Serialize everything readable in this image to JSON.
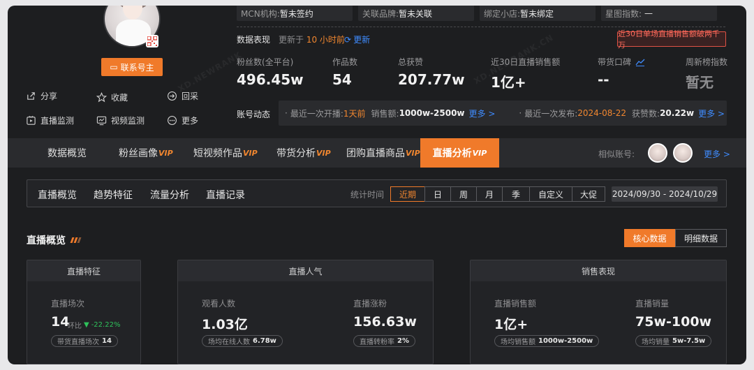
{
  "profile": {
    "contact_button": "联系号主",
    "actions": [
      {
        "label": "分享",
        "icon": "share-icon"
      },
      {
        "label": "收藏",
        "icon": "star-icon"
      },
      {
        "label": "回采",
        "icon": "enter-icon"
      },
      {
        "label": "直播监测",
        "icon": "live-monitor-icon"
      },
      {
        "label": "视频监测",
        "icon": "video-monitor-icon"
      },
      {
        "label": "更多",
        "icon": "more-icon"
      }
    ]
  },
  "info_top": {
    "mcn_label": "MCN机构:",
    "mcn_value": "暂未签约",
    "brand_label": "关联品牌:",
    "brand_value": "暂未关联",
    "shop_label": "绑定小店:",
    "shop_value": "暂未绑定",
    "star_label": "星图指数:",
    "star_value": "—"
  },
  "data_perf": {
    "title": "数据表现",
    "updated_prefix": "更新于",
    "updated_value": "10 小时前",
    "refresh": "更新",
    "alert": "近30日单场直播销售额破两千万"
  },
  "stats": [
    {
      "label": "粉丝数(全平台)",
      "value": "496.45w"
    },
    {
      "label": "作品数",
      "value": "54"
    },
    {
      "label": "总获赞",
      "value": "207.77w"
    },
    {
      "label": "近30日直播销售额",
      "value": "1亿+"
    },
    {
      "label": "带货口碑",
      "value": "--"
    },
    {
      "label": "周新榜指数",
      "value": "暂无"
    }
  ],
  "dynamics": {
    "title": "账号动态",
    "live_label": "最近一次开播:",
    "live_value": "1天前",
    "sales_label": "销售额:",
    "sales_value": "1000w-2500w",
    "more1": "更多 >",
    "publish_label": "最近一次发布:",
    "publish_value": "2024-08-22",
    "likes_label": "获赞数:",
    "likes_value": "20.22w",
    "more2": "更多 >"
  },
  "tabs": [
    {
      "label": "数据概览",
      "vip": ""
    },
    {
      "label": "粉丝画像",
      "vip": "VIP"
    },
    {
      "label": "短视频作品",
      "vip": "VIP"
    },
    {
      "label": "带货分析",
      "vip": "VIP"
    },
    {
      "label": "团购直播商品",
      "vip": "VIP"
    },
    {
      "label": "直播分析",
      "vip": "VIP"
    }
  ],
  "similar": {
    "label": "相似账号:",
    "more": "更多 >"
  },
  "subnav": {
    "items": [
      "直播概览",
      "趋势特征",
      "流量分析",
      "直播记录"
    ],
    "time_label": "统计时间",
    "periods": [
      "近期",
      "日",
      "周",
      "月",
      "季",
      "自定义",
      "大促"
    ],
    "date_range": "2024/09/30 - 2024/10/29"
  },
  "overview": {
    "title": "直播概览",
    "core_button": "核心数据",
    "detail_button": "明细数据",
    "cards": {
      "feature": {
        "head": "直播特征",
        "label": "直播场次",
        "value": "14",
        "ratio_label": "环比",
        "ratio_value": "-22.22%",
        "pill_label": "带货直播场次",
        "pill_value": "14"
      },
      "popularity": {
        "head": "直播人气",
        "viewers_label": "观看人数",
        "viewers_value": "1.03亿",
        "viewers_pill_label": "场均在线人数",
        "viewers_pill_value": "6.78w",
        "fans_label": "直播涨粉",
        "fans_value": "156.63w",
        "fans_pill_label": "直播转粉率",
        "fans_pill_value": "2%"
      },
      "sales": {
        "head": "销售表现",
        "amount_label": "直播销售额",
        "amount_value": "1亿+",
        "amount_pill_label": "场均销售额",
        "amount_pill_value": "1000w-2500w",
        "volume_label": "直播销量",
        "volume_value": "75w-100w",
        "volume_pill_label": "场均销量",
        "volume_pill_value": "5w-7.5w"
      }
    }
  },
  "colors": {
    "accent": "#f07a2a",
    "link": "#3f8cff",
    "alert": "#e05245",
    "down": "#2fc25b"
  }
}
